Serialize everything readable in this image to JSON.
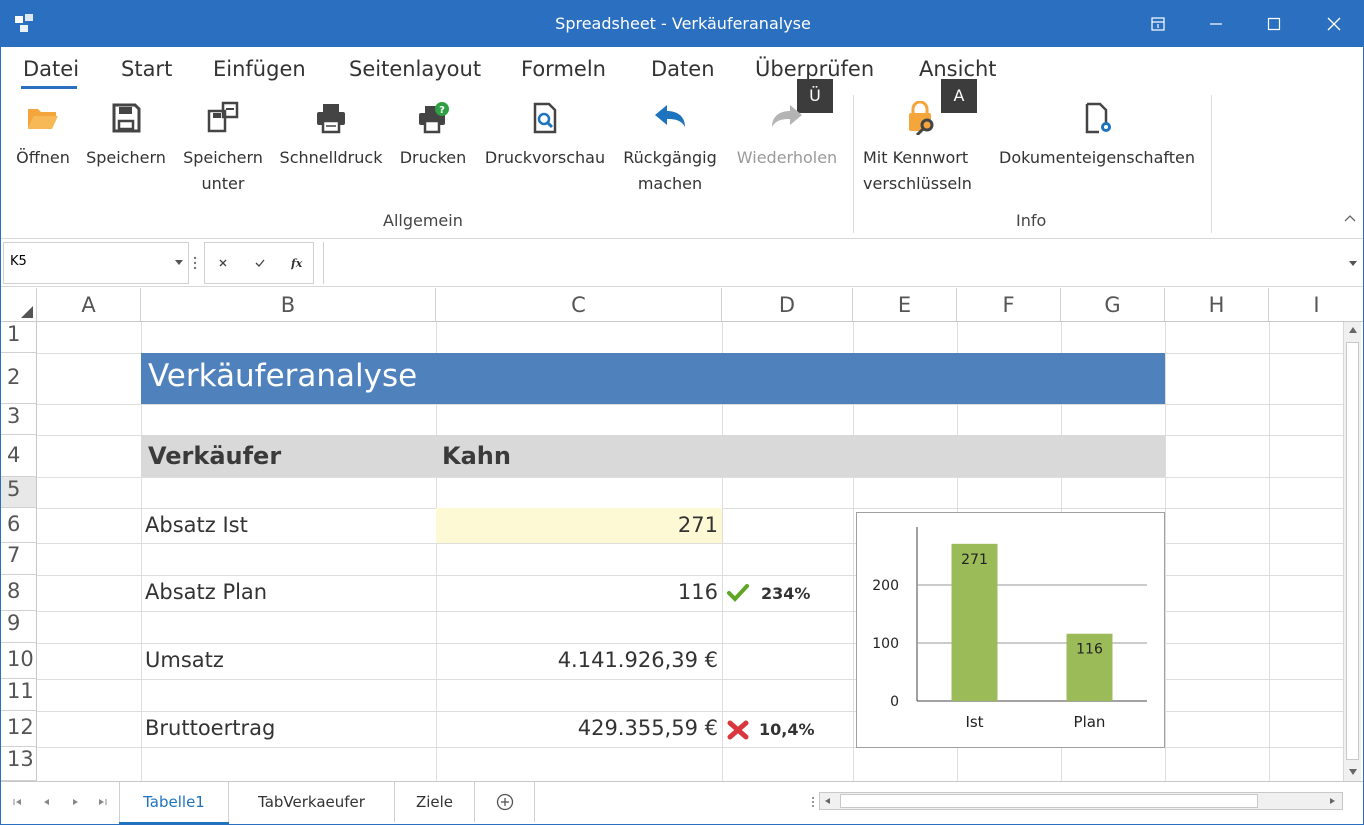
{
  "window": {
    "title": "Spreadsheet - Verkäuferanalyse",
    "controls": [
      "⊞",
      "—",
      "☐",
      "✕"
    ]
  },
  "ribbon": {
    "tabs": [
      "Datei",
      "Start",
      "Einfügen",
      "Seitenlayout",
      "Formeln",
      "Daten",
      "Überprüfen",
      "Ansicht"
    ],
    "keytips": [
      "Ü",
      "A"
    ],
    "buttons": {
      "open": "Öffnen",
      "save": "Speichern",
      "save_as_1": "Speichern",
      "save_as_2": "unter",
      "quick_print": "Schnelldruck",
      "print": "Drucken",
      "print_preview": "Druckvorschau",
      "undo_1": "Rückgängig",
      "undo_2": "machen",
      "redo": "Wiederholen",
      "encrypt_1": "Mit Kennwort",
      "encrypt_2": "verschlüsseln",
      "doc_props": "Dokumenteigenschaften"
    },
    "groups": {
      "general": "Allgemein",
      "info": "Info"
    }
  },
  "formula_bar": {
    "name_box": "K5",
    "value": ""
  },
  "grid": {
    "columns": [
      "A",
      "B",
      "C",
      "D",
      "E",
      "F",
      "G",
      "H",
      "I"
    ],
    "rows": [
      "1",
      "2",
      "3",
      "4",
      "5",
      "6",
      "7",
      "8",
      "9",
      "10",
      "11",
      "12",
      "13"
    ],
    "title": "Verkäuferanalyse",
    "header_label": "Verkäufer",
    "header_value": "Kahn",
    "absatz_ist_label": "Absatz Ist",
    "absatz_ist_value": "271",
    "absatz_plan_label": "Absatz Plan",
    "absatz_plan_value": "116",
    "absatz_pct": "234%",
    "umsatz_label": "Umsatz",
    "umsatz_value": "4.141.926,39 €",
    "bruttoertrag_label": "Bruttoertrag",
    "bruttoertrag_value": "429.355,59 €",
    "bruttoertrag_pct": "10,4%",
    "colors": {
      "title_bg": "#4f81bd",
      "header_bg": "#d9d9d9",
      "highlight": "#fdf9d5",
      "check": "#5fa624",
      "cross": "#d9363e"
    }
  },
  "chart_data": {
    "type": "bar",
    "categories": [
      "Ist",
      "Plan"
    ],
    "values": [
      271,
      116
    ],
    "ylim": [
      0,
      300
    ],
    "yticks": [
      0,
      100,
      200
    ],
    "bar_color": "#9bbb59",
    "grid": true
  },
  "sheets": {
    "tabs": [
      "Tabelle1",
      "TabVerkaeufer",
      "Ziele"
    ],
    "active": "Tabelle1"
  }
}
